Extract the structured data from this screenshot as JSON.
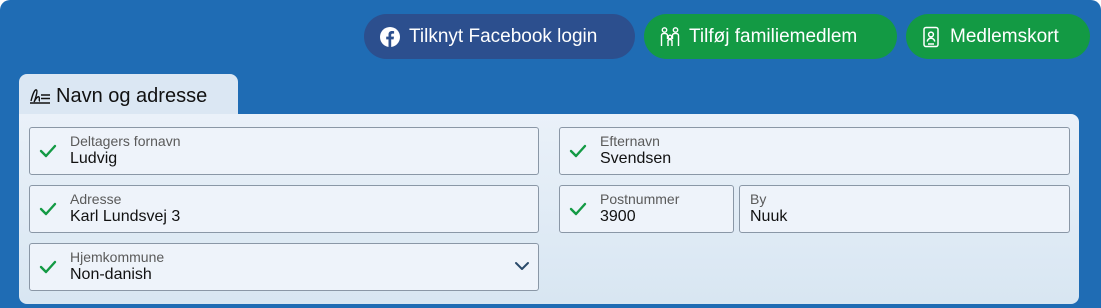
{
  "header": {
    "facebook_label": "Tilknyt Facebook login",
    "family_label": "Tilføj familiemedlem",
    "card_label": "Medlemskort"
  },
  "tab": {
    "label": "Navn og adresse"
  },
  "form": {
    "first_name": {
      "label": "Deltagers fornavn",
      "value": "Ludvig"
    },
    "last_name": {
      "label": "Efternavn",
      "value": "Svendsen"
    },
    "address": {
      "label": "Adresse",
      "value": "Karl Lundsvej 3"
    },
    "postal_code": {
      "label": "Postnummer",
      "value": "3900"
    },
    "city": {
      "label": "By",
      "value": "Nuuk"
    },
    "municipality": {
      "label": "Hjemkommune",
      "value": "Non-danish"
    }
  },
  "colors": {
    "background": "#1f6cb4",
    "facebook_button": "#2c4f8e",
    "green_button": "#139a44",
    "check": "#139a44"
  },
  "icons": {
    "facebook": "facebook-icon",
    "family": "family-icon",
    "card": "member-card-icon",
    "tab": "signature-icon",
    "check": "check-icon",
    "dropdown": "chevron-down-icon"
  }
}
